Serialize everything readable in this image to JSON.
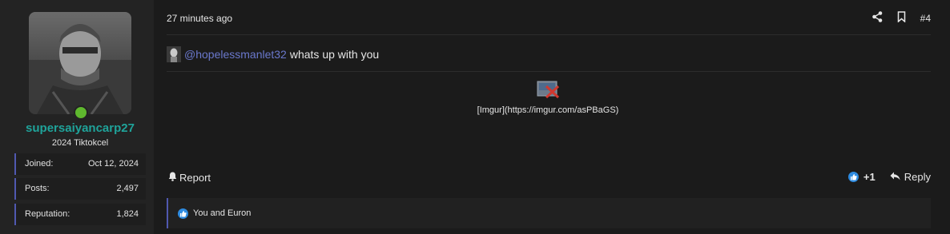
{
  "user": {
    "username": "supersaiyancarp27",
    "title": "2024 Tiktokcel",
    "online": true,
    "stats": [
      {
        "label": "Joined:",
        "value": "Oct 12, 2024"
      },
      {
        "label": "Posts:",
        "value": "2,497"
      },
      {
        "label": "Reputation:",
        "value": "1,824"
      }
    ]
  },
  "post": {
    "timestamp": "27 minutes ago",
    "number": "#4",
    "mention": "@hopelessmanlet32",
    "message": "whats up with you",
    "image_link_text": "[Imgur](https://imgur.com/asPBaGS)",
    "report_label": "Report",
    "like_count": "+1",
    "reply_label": "Reply",
    "reactions_text": "You and Euron"
  },
  "colors": {
    "accent": "#5058b0",
    "username": "#1fa39a",
    "mention": "#6a78cc",
    "online": "#5fb82e",
    "like": "#2e8be0"
  },
  "icons": [
    "share-icon",
    "bookmark-icon",
    "bell-icon",
    "like-icon",
    "reply-icon",
    "broken-image-icon"
  ]
}
